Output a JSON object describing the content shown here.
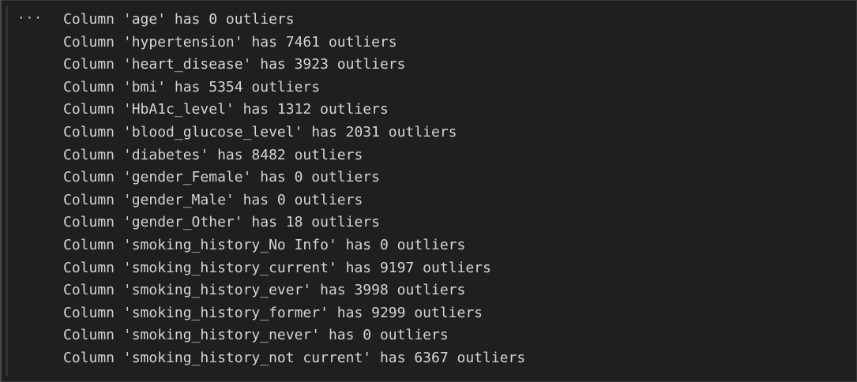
{
  "output": {
    "more_label": "···",
    "lines": [
      "Column 'age' has 0 outliers",
      "Column 'hypertension' has 7461 outliers",
      "Column 'heart_disease' has 3923 outliers",
      "Column 'bmi' has 5354 outliers",
      "Column 'HbA1c_level' has 1312 outliers",
      "Column 'blood_glucose_level' has 2031 outliers",
      "Column 'diabetes' has 8482 outliers",
      "Column 'gender_Female' has 0 outliers",
      "Column 'gender_Male' has 0 outliers",
      "Column 'gender_Other' has 18 outliers",
      "Column 'smoking_history_No Info' has 0 outliers",
      "Column 'smoking_history_current' has 9197 outliers",
      "Column 'smoking_history_ever' has 3998 outliers",
      "Column 'smoking_history_former' has 9299 outliers",
      "Column 'smoking_history_never' has 0 outliers",
      "Column 'smoking_history_not current' has 6367 outliers"
    ]
  }
}
